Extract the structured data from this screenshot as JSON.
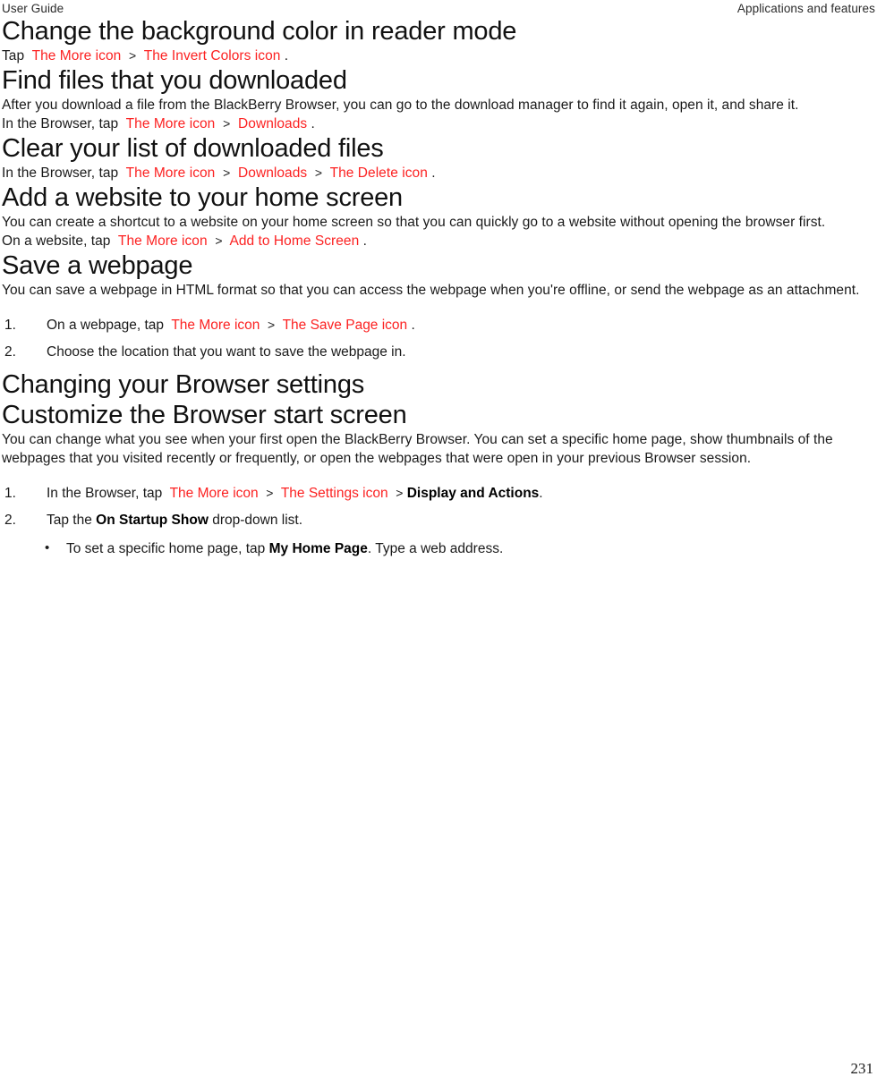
{
  "header": {
    "left": "User Guide",
    "right": "Applications and features"
  },
  "footer": {
    "page_number": "231"
  },
  "colors": {
    "ui_reference_red": "#fc2222",
    "text": "#1a1a1a",
    "background": "#ffffff"
  },
  "separator": ">",
  "period": ".",
  "sections": {
    "change_background": {
      "heading": "Change the background color in reader mode",
      "step_prefix": "Tap",
      "ref_more": "The More icon",
      "ref_invert": "The Invert Colors icon"
    },
    "find_files": {
      "heading": "Find files that you downloaded",
      "paragraph": "After you download a file from the BlackBerry Browser, you can go to the download manager to find it again, open it, and share it.",
      "step_prefix": "In the Browser, tap",
      "ref_more": "The More icon",
      "ref_downloads": "Downloads"
    },
    "clear_list": {
      "heading": "Clear your list of downloaded files",
      "step_prefix": "In the Browser, tap",
      "ref_more": "The More icon",
      "ref_downloads": "Downloads",
      "ref_delete": "The Delete icon"
    },
    "add_website": {
      "heading": "Add a website to your home screen",
      "paragraph": "You can create a shortcut to a website on your home screen so that you can quickly go to a website without opening the browser first.",
      "step_prefix": "On a website, tap",
      "ref_more": "The More icon",
      "ref_add_home": "Add to Home Screen"
    },
    "save_webpage": {
      "heading": "Save a webpage",
      "paragraph": "You can save a webpage in HTML format so that you can access the webpage when you're offline, or send the webpage as an attachment.",
      "steps": [
        {
          "prefix": "On a webpage, tap",
          "ref_more": "The More icon",
          "ref_save_page": "The Save Page icon"
        },
        {
          "text": "Choose the location that you want to save the webpage in."
        }
      ]
    },
    "changing_settings": {
      "heading": "Changing your Browser settings"
    },
    "customize_start_screen": {
      "heading": "Customize the Browser start screen",
      "paragraph": "You can change what you see when your first open the BlackBerry Browser. You can set a specific home page, show thumbnails of the webpages that you visited recently or frequently, or open the webpages that were open in your previous Browser session.",
      "step1": {
        "prefix": "In the Browser, tap",
        "ref_more": "The More icon",
        "ref_settings": "The Settings icon",
        "bold_target": "Display and Actions"
      },
      "step2": {
        "prefix": "Tap the",
        "bold_target": "On Startup Show",
        "suffix": "drop-down list."
      },
      "bullets": [
        {
          "prefix": "To set a specific home page, tap",
          "bold_target": "My Home Page",
          "suffix": "Type a web address."
        }
      ]
    }
  }
}
